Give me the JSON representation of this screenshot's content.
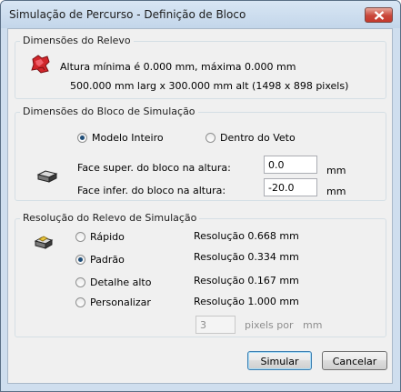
{
  "window": {
    "title": "Simulação de Percurso - Definição de Bloco"
  },
  "relevo": {
    "group_title": "Dimensões do Relevo",
    "altura_text": "Altura mínima é 0.000 mm, máxima 0.000 mm",
    "dimensoes_text": "500.000 mm larg x 300.000 mm alt (1498 x 898 pixels)",
    "icon": "red-relief-icon"
  },
  "bloco": {
    "group_title": "Dimensões do Bloco de Simulação",
    "options": [
      {
        "label": "Modelo Inteiro",
        "checked": true
      },
      {
        "label": "Dentro do Veto",
        "checked": false
      }
    ],
    "face_super_label": "Face super. do bloco na altura:",
    "face_super_value": "0.0",
    "face_infer_label": "Face infer. do bloco na altura:",
    "face_infer_value": "-20.0",
    "unit": "mm",
    "icon": "block-icon"
  },
  "resolucao": {
    "group_title": "Resolução do Relevo de Simulação",
    "options": [
      {
        "label": "Rápido",
        "resolution": "Resolução 0.668 mm",
        "checked": false
      },
      {
        "label": "Padrão",
        "resolution": "Resolução 0.334 mm",
        "checked": true
      },
      {
        "label": "Detalhe alto",
        "resolution": "Resolução 0.167 mm",
        "checked": false
      },
      {
        "label": "Personalizar",
        "resolution": "Resolução 1.000 mm",
        "checked": false
      }
    ],
    "custom_value": "3",
    "pixels_por": "pixels por",
    "mm": "mm",
    "icon": "resolution-block-icon"
  },
  "buttons": {
    "simular": "Simular",
    "cancelar": "Cancelar"
  }
}
